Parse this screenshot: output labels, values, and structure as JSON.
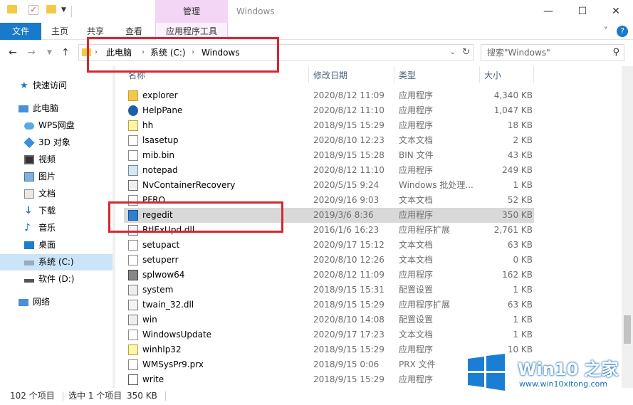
{
  "titlebar": {
    "manage_tab": "管理",
    "window_title": "Windows",
    "minimize": "—",
    "maximize": "☐",
    "close": "✕"
  },
  "ribbon": {
    "tabs": [
      "文件",
      "主页",
      "共享",
      "查看",
      "应用程序工具"
    ],
    "expand": "˅",
    "help": "?"
  },
  "address": {
    "crumbs": [
      "此电脑",
      "系统 (C:)",
      "Windows"
    ],
    "search_placeholder": "搜索\"Windows\""
  },
  "sidebar": {
    "items": [
      {
        "label": "快速访问",
        "icon": "star-icon"
      },
      {
        "label": "此电脑",
        "icon": "computer-icon"
      },
      {
        "label": "WPS网盘",
        "icon": "cloud-icon"
      },
      {
        "label": "3D 对象",
        "icon": "cube-icon"
      },
      {
        "label": "视频",
        "icon": "video-icon"
      },
      {
        "label": "图片",
        "icon": "picture-icon"
      },
      {
        "label": "文档",
        "icon": "document-icon"
      },
      {
        "label": "下载",
        "icon": "download-icon"
      },
      {
        "label": "音乐",
        "icon": "music-icon"
      },
      {
        "label": "桌面",
        "icon": "desktop-icon"
      },
      {
        "label": "系统 (C:)",
        "icon": "drive-icon"
      },
      {
        "label": "软件 (D:)",
        "icon": "drive-icon"
      },
      {
        "label": "网络",
        "icon": "network-icon"
      }
    ]
  },
  "columns": {
    "name": "名称",
    "date": "修改日期",
    "type": "类型",
    "size": "大小"
  },
  "files": [
    {
      "name": "explorer",
      "date": "2020/8/12 11:09",
      "type": "应用程序",
      "size": "4,340 KB",
      "icon": "folder-app-icon"
    },
    {
      "name": "HelpPane",
      "date": "2020/8/12 11:10",
      "type": "应用程序",
      "size": "1,047 KB",
      "icon": "help-icon"
    },
    {
      "name": "hh",
      "date": "2018/9/15 15:29",
      "type": "应用程序",
      "size": "18 KB",
      "icon": "help-doc-icon"
    },
    {
      "name": "lsasetup",
      "date": "2020/8/10 12:23",
      "type": "文本文档",
      "size": "2 KB",
      "icon": "text-file-icon"
    },
    {
      "name": "mib.bin",
      "date": "2018/9/15 15:28",
      "type": "BIN 文件",
      "size": "43 KB",
      "icon": "file-icon"
    },
    {
      "name": "notepad",
      "date": "2020/8/12 11:10",
      "type": "应用程序",
      "size": "249 KB",
      "icon": "notepad-icon"
    },
    {
      "name": "NvContainerRecovery",
      "date": "2020/5/15 9:24",
      "type": "Windows 批处理...",
      "size": "1 KB",
      "icon": "batch-file-icon"
    },
    {
      "name": "PFRO",
      "date": "2020/9/16 9:03",
      "type": "文本文档",
      "size": "52 KB",
      "icon": "text-file-icon"
    },
    {
      "name": "regedit",
      "date": "2019/3/6 8:36",
      "type": "应用程序",
      "size": "350 KB",
      "icon": "regedit-icon"
    },
    {
      "name": "RtlExUpd.dll",
      "date": "2016/1/6 16:23",
      "type": "应用程序扩展",
      "size": "2,761 KB",
      "icon": "dll-icon"
    },
    {
      "name": "setupact",
      "date": "2020/9/17 15:12",
      "type": "文本文档",
      "size": "63 KB",
      "icon": "text-file-icon"
    },
    {
      "name": "setuperr",
      "date": "2020/8/10 12:26",
      "type": "文本文档",
      "size": "0 KB",
      "icon": "text-file-icon"
    },
    {
      "name": "splwow64",
      "date": "2020/8/12 11:09",
      "type": "应用程序",
      "size": "162 KB",
      "icon": "printer-icon"
    },
    {
      "name": "system",
      "date": "2018/9/15 15:31",
      "type": "配置设置",
      "size": "1 KB",
      "icon": "settings-file-icon"
    },
    {
      "name": "twain_32.dll",
      "date": "2018/9/15 15:29",
      "type": "应用程序扩展",
      "size": "63 KB",
      "icon": "dll-icon"
    },
    {
      "name": "win",
      "date": "2020/8/10 14:08",
      "type": "配置设置",
      "size": "1 KB",
      "icon": "settings-file-icon"
    },
    {
      "name": "WindowsUpdate",
      "date": "2020/9/17 17:23",
      "type": "文本文档",
      "size": "1 KB",
      "icon": "text-file-icon"
    },
    {
      "name": "winhlp32",
      "date": "2018/9/15 15:29",
      "type": "应用程序",
      "size": "10 KB",
      "icon": "help-doc-icon"
    },
    {
      "name": "WMSysPr9.prx",
      "date": "2018/9/15 0:06",
      "type": "PRX 文件",
      "size": "",
      "icon": "file-icon"
    },
    {
      "name": "write",
      "date": "2018/9/15 15:29",
      "type": "应用程序",
      "size": "",
      "icon": "write-icon"
    }
  ],
  "status": {
    "count": "102 个项目",
    "selected": "选中 1 个项目",
    "size": "350 KB"
  },
  "watermark": {
    "title": "Win10 之家",
    "url": "www.win10xitong.com"
  },
  "colors": {
    "accent": "#1979ca",
    "annotation": "#d8262f",
    "selected_row": "#d9d9d9",
    "manage_tab": "#f3d6f5"
  }
}
